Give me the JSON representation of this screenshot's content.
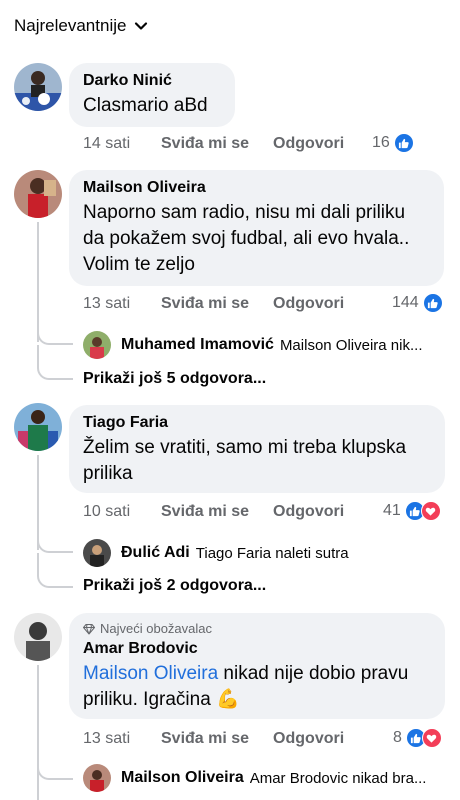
{
  "sort": {
    "label": "Najrelevantnije"
  },
  "actions": {
    "like": "Sviđa mi se",
    "reply": "Odgovori"
  },
  "colors": {
    "like_blue": "#1b74e4",
    "love_red": "#f33e58",
    "mention": "#216fdb",
    "bubble": "#f0f2f5",
    "meta": "#65676b"
  },
  "comments": [
    {
      "author": "Darko Ninić",
      "text": "Clasmario aBd",
      "time": "14 sati",
      "reactions": "16",
      "reaction_icons": [
        "like-icon"
      ]
    },
    {
      "author": "Mailson Oliveira",
      "text": "Naporno sam radio, nisu mi dali priliku da pokažem svoj fudbal, ali evo hvala.. Volim te zeljo",
      "time": "13 sati",
      "reactions": "144",
      "reaction_icons": [
        "like-icon"
      ],
      "reply": {
        "author": "Muhamed Imamović",
        "text": "Mailson Oliveira nik..."
      },
      "more": "Prikaži još 5 odgovora..."
    },
    {
      "author": "Tiago Faria",
      "text": "Želim se vratiti, samo mi treba klupska prilika",
      "time": "10 sati",
      "reactions": "41",
      "reaction_icons": [
        "like-icon",
        "love-icon"
      ],
      "reply": {
        "author": "Đulić Adi",
        "text": "Tiago Faria naleti sutra"
      },
      "more": "Prikaži još 2 odgovora..."
    },
    {
      "badge": "Najveći obožavalac",
      "author": "Amar Brodovic",
      "mention": "Mailson Oliveira",
      "text": " nikad nije dobio pravu priliku. Igračina 💪",
      "time": "13 sati",
      "reactions": "8",
      "reaction_icons": [
        "like-icon",
        "love-icon"
      ],
      "reply": {
        "author": "Mailson Oliveira",
        "text": "Amar Brodovic nikad bra..."
      }
    }
  ]
}
